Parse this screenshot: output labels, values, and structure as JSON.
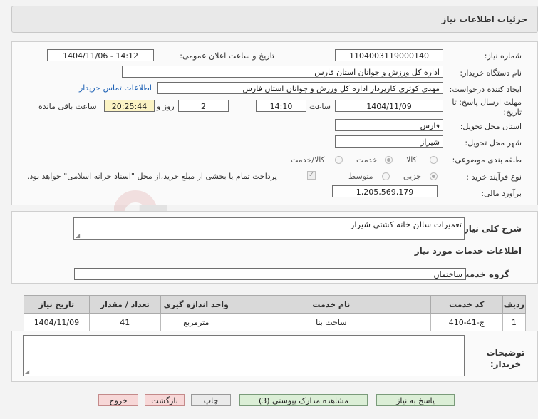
{
  "header": {
    "title": "جزئیات اطلاعات نیاز"
  },
  "fields": {
    "need_number_label": "شماره نیاز:",
    "need_number": "1104003119000140",
    "announce_label": "تاریخ و ساعت اعلان عمومی:",
    "announce_value": "1404/11/06 - 14:12",
    "buyer_org_label": "نام دستگاه خریدار:",
    "buyer_org": "اداره کل ورزش و جوانان استان فارس",
    "creator_label": "ایجاد کننده درخواست:",
    "creator": "مهدی کوثری کارپرداز اداره کل ورزش و جوانان استان فارس",
    "contact_link": "اطلاعات تماس خریدار",
    "deadline_label": "مهلت ارسال پاسخ: تا تاریخ:",
    "deadline_date": "1404/11/09",
    "time_label": "ساعت",
    "deadline_time": "14:10",
    "days_value": "2",
    "days_label": "روز و",
    "remaining_time": "20:25:44",
    "remaining_label": "ساعت باقی مانده",
    "province_label": "استان محل تحویل:",
    "province": "فارس",
    "city_label": "شهر محل تحویل:",
    "city": "شیراز",
    "category_label": "طبقه بندی موضوعی:",
    "category_options": [
      "کالا",
      "خدمت",
      "کالا/خدمت"
    ],
    "category_selected": "خدمت",
    "process_label": "نوع فرآیند خرید :",
    "process_options": [
      "جزیی",
      "متوسط"
    ],
    "process_selected": "جزیی",
    "payment_note": "پرداخت تمام یا بخشی از مبلغ خرید،از محل \"اسناد خزانه اسلامی\" خواهد بود.",
    "estimate_label": "برآورد مالی:",
    "estimate": "1,205,569,179"
  },
  "description": {
    "label": "شرح کلی نیاز:",
    "value": "تعمیرات سالن خانه کشتی شیراز"
  },
  "services": {
    "section_title": "اطلاعات خدمات مورد نیاز",
    "group_label": "گروه خدمت:",
    "group_value": "ساختمان",
    "columns": [
      "ردیف",
      "کد خدمت",
      "نام خدمت",
      "واحد اندازه گیری",
      "تعداد / مقدار",
      "تاریخ نیاز"
    ],
    "rows": [
      [
        "1",
        "ج-41-410",
        "ساخت بنا",
        "مترمربع",
        "41",
        "1404/11/09"
      ]
    ]
  },
  "buyer_notes": {
    "label": "توضیحات خریدار:",
    "value": ""
  },
  "buttons": {
    "reply": "پاسخ به نیاز",
    "attachments": "مشاهده مدارک پیوستی (3)",
    "print": "چاپ",
    "back": "بازگشت",
    "exit": "خروج"
  },
  "watermark": "AriaTender.neT",
  "colors": {
    "accent_green": "#dbeed6",
    "remaining_bg": "#fbf3c4",
    "link": "#1a5fb4"
  }
}
